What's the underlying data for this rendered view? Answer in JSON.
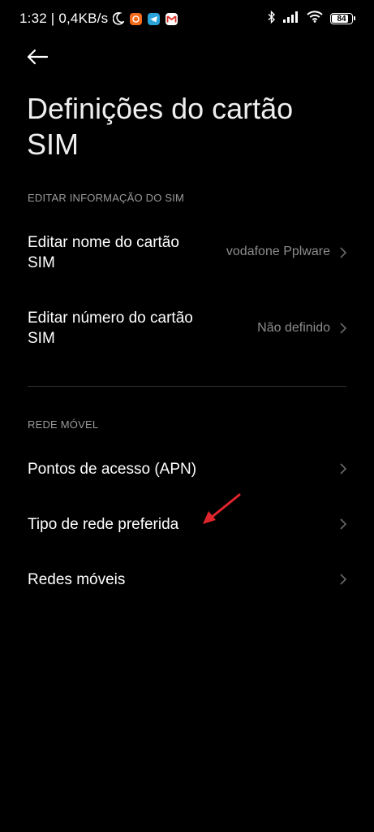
{
  "status_bar": {
    "time_speed": "1:32 | 0,4KB/s",
    "battery_level": "84",
    "battery_fraction": 0.84,
    "icons": [
      "moon-icon",
      "orange-app-icon",
      "telegram-icon",
      "gmail-icon",
      "bluetooth-icon",
      "signal-icon",
      "wifi-icon",
      "battery-icon"
    ]
  },
  "header": {
    "title": "Definições do cartão SIM"
  },
  "sections": {
    "sim_info": {
      "header": "EDITAR INFORMAÇÃO DO SIM",
      "edit_name_label": "Editar nome do cartão SIM",
      "edit_name_value": "vodafone Pplware",
      "edit_number_label": "Editar número do cartão SIM",
      "edit_number_value": "Não definido"
    },
    "mobile_network": {
      "header": "REDE MÓVEL",
      "access_points_label": "Pontos de acesso (APN)",
      "preferred_network_label": "Tipo de rede preferida",
      "mobile_networks_label": "Redes móveis"
    }
  },
  "colors": {
    "background": "#000000",
    "primary_text": "#ffffff",
    "secondary_text": "#8c8c8c",
    "annotation_arrow": "#e0242b"
  }
}
